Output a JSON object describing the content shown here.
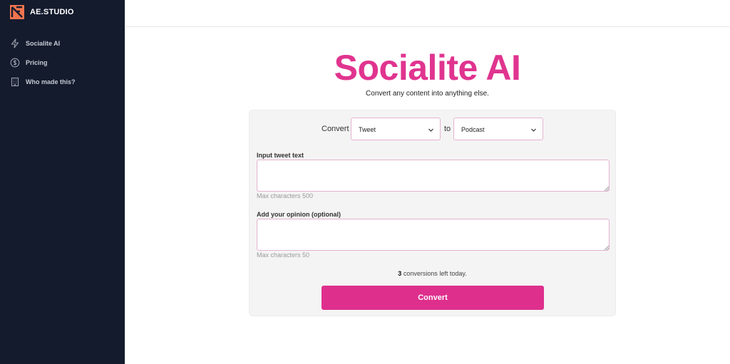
{
  "sidebar": {
    "brand": "AE.STUDIO",
    "items": [
      {
        "label": "Socialite AI",
        "icon": "bolt-icon"
      },
      {
        "label": "Pricing",
        "icon": "dollar-circle-icon"
      },
      {
        "label": "Who made this?",
        "icon": "building-icon"
      }
    ]
  },
  "main": {
    "title": "Socialite AI",
    "subtitle": "Convert any content into anything else.",
    "form": {
      "convert_label": "Convert",
      "to_label": "to",
      "from_select": {
        "value": "Tweet"
      },
      "to_select": {
        "value": "Podcast"
      },
      "input_label": "Input tweet text",
      "input_value": "",
      "input_hint": "Max characters 500",
      "opinion_label": "Add your opinion (optional)",
      "opinion_value": "",
      "opinion_hint": "Max characters 50",
      "conversions_left_count": "3",
      "conversions_left_text": " conversions left today.",
      "submit_label": "Convert"
    }
  },
  "colors": {
    "sidebar_bg": "#141b2d",
    "accent": "#de2f8d",
    "title": "#e0348f",
    "brand_logo": "#f0744f"
  }
}
